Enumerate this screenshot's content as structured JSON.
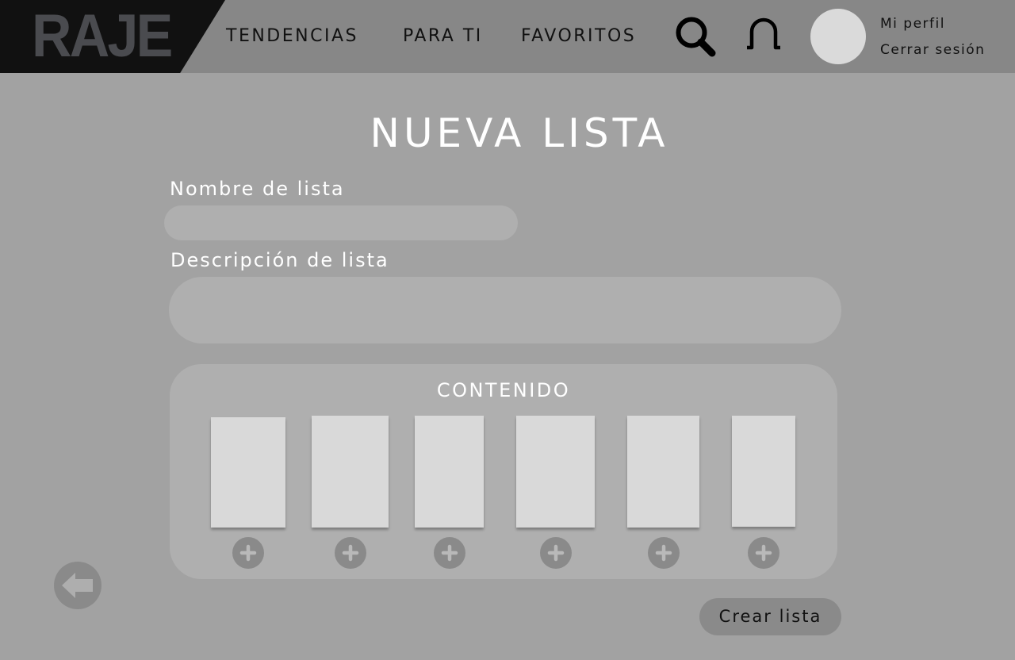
{
  "header": {
    "logo": "RAJE",
    "nav": [
      "TENDENCIAS",
      "PARA TI",
      "FAVORITOS"
    ],
    "icons": {
      "search": "search-icon",
      "notifications": "bell-icon"
    },
    "profile": {
      "my_profile": "Mi perfil",
      "logout": "Cerrar sesión"
    }
  },
  "main": {
    "title": "NUEVA LISTA",
    "name_label": "Nombre de lista",
    "name_value": "",
    "description_label": "Descripción de lista",
    "description_value": "",
    "content_title": "CONTENIDO",
    "content_slots": 6,
    "add_icon": "plus-icon",
    "back_icon": "arrow-left-icon",
    "create_button": "Crear lista"
  },
  "colors": {
    "page_bg": "#a2a2a2",
    "header_bg": "#878787",
    "logo_bg": "#111111",
    "logo_text": "#4a4b4f",
    "panel": "#afafaf",
    "slot": "#d9d9d9",
    "button": "#8a8a8a",
    "title_text": "#ffffff"
  }
}
